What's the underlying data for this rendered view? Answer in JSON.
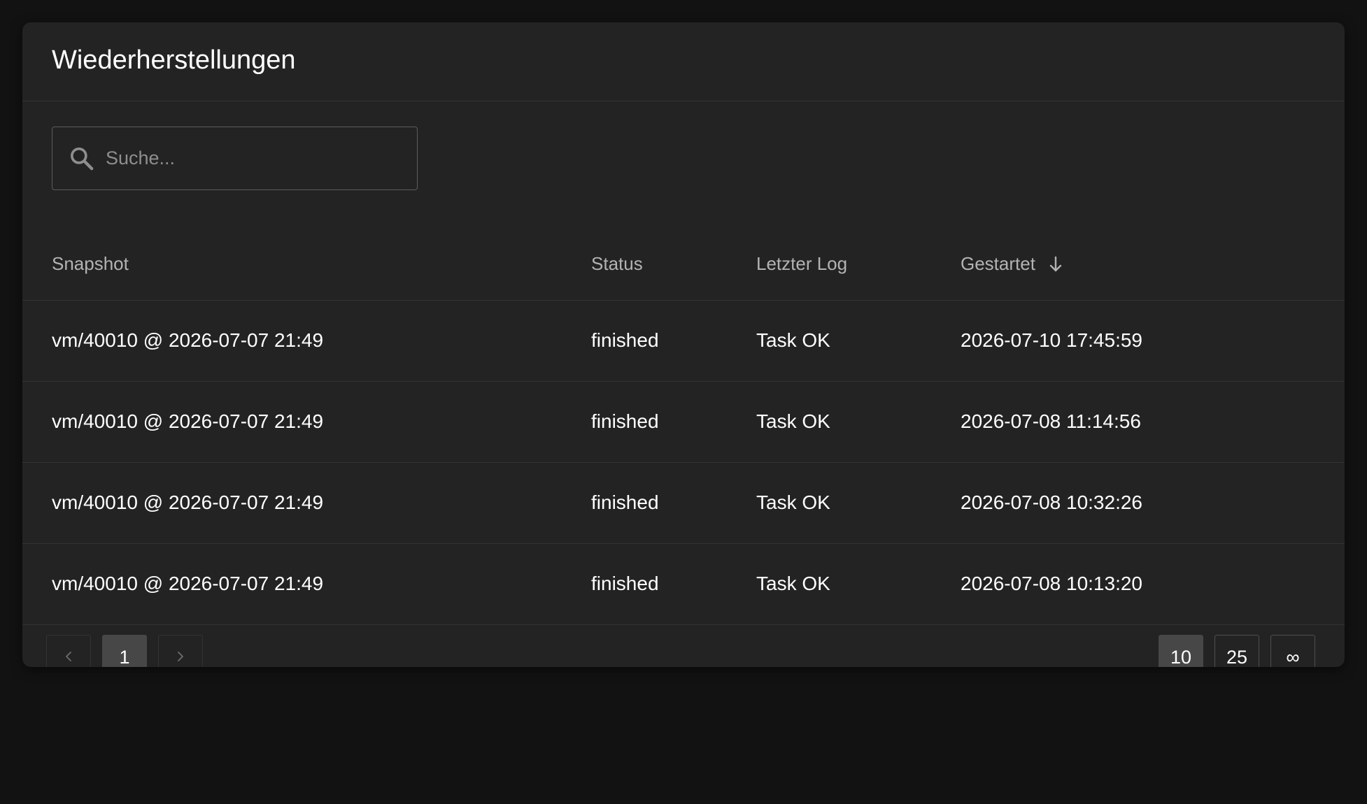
{
  "header": {
    "title": "Wiederherstellungen"
  },
  "search": {
    "placeholder": "Suche...",
    "value": ""
  },
  "table": {
    "columns": [
      "Snapshot",
      "Status",
      "Letzter Log",
      "Gestartet"
    ],
    "sort": {
      "column": "Gestartet",
      "direction": "descending"
    },
    "rows": [
      {
        "snapshot": "vm/40010 @ 2026-07-07 21:49",
        "status": "finished",
        "log": "Task OK",
        "started": "2026-07-10 17:45:59"
      },
      {
        "snapshot": "vm/40010 @ 2026-07-07 21:49",
        "status": "finished",
        "log": "Task OK",
        "started": "2026-07-08 11:14:56"
      },
      {
        "snapshot": "vm/40010 @ 2026-07-07 21:49",
        "status": "finished",
        "log": "Task OK",
        "started": "2026-07-08 10:32:26"
      },
      {
        "snapshot": "vm/40010 @ 2026-07-07 21:49",
        "status": "finished",
        "log": "Task OK",
        "started": "2026-07-08 10:13:20"
      }
    ]
  },
  "pagination": {
    "prev_icon": "chevron-left-icon",
    "next_icon": "chevron-right-icon",
    "current_page": "1",
    "page_sizes": [
      "10",
      "25",
      "∞"
    ],
    "selected_page_size": "10"
  },
  "colors": {
    "background": "#121212",
    "card": "#232323",
    "divider": "#333333",
    "active_button": "#474747"
  }
}
